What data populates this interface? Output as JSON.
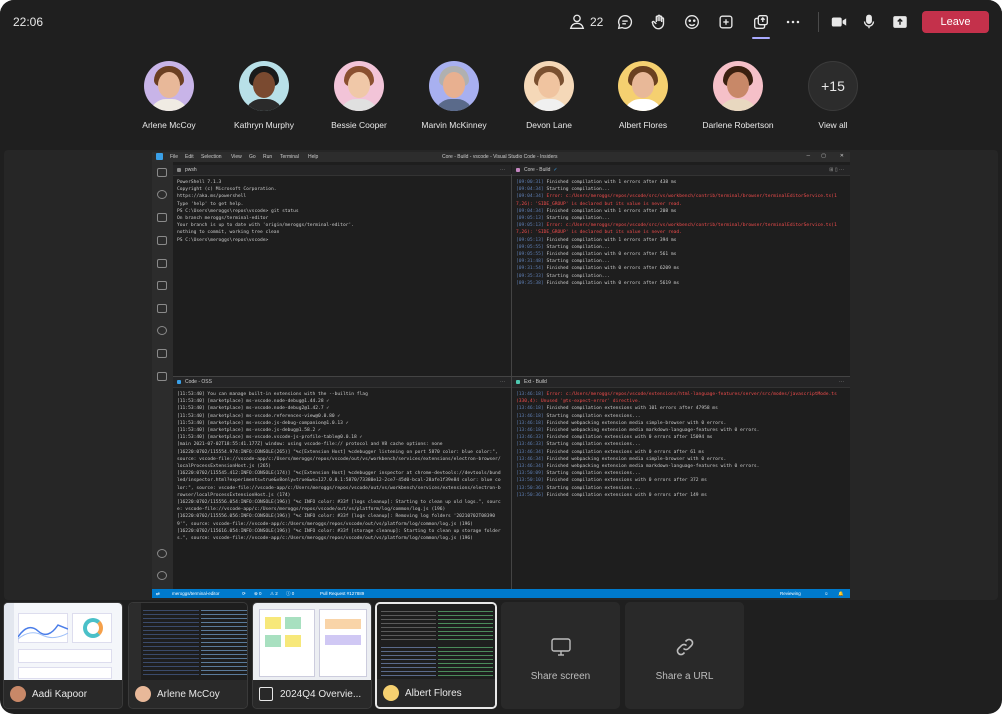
{
  "meeting": {
    "time": "22:06",
    "participant_count": "22",
    "leave_label": "Leave",
    "colors": {
      "leave": "#c4314b",
      "accent": "#a9aaff",
      "background": "#1f1f1f"
    }
  },
  "toolbar": {
    "icons": [
      "people-icon",
      "chat-icon",
      "raise-hand-icon",
      "reactions-icon",
      "apps-icon",
      "share-tray-icon",
      "more-icon",
      "camera-icon",
      "mic-icon",
      "share-icon"
    ]
  },
  "participants": [
    {
      "name": "Arlene McCoy"
    },
    {
      "name": "Kathryn Murphy"
    },
    {
      "name": "Bessie Cooper"
    },
    {
      "name": "Marvin McKinney"
    },
    {
      "name": "Devon Lane"
    },
    {
      "name": "Albert Flores"
    },
    {
      "name": "Darlene Robertson"
    }
  ],
  "overflow": {
    "count": "+15",
    "view_all_label": "View all"
  },
  "vscode": {
    "menu": [
      "File",
      "Edit",
      "Selection",
      "View",
      "Go",
      "Run",
      "Terminal",
      "Help"
    ],
    "title": "Core - Build - vscode - Visual Studio Code - Insiders",
    "panes": {
      "top_left": {
        "title": "pwsh",
        "lines": [
          "PowerShell 7.1.3",
          "Copyright (c) Microsoft Corporation.",
          "",
          "https://aka.ms/powershell",
          "Type 'help' to get help.",
          "",
          "PS C:\\Users\\meroggs\\repos\\vscode> git status",
          "On branch meroggs/terminal-editor",
          "Your branch is up to date with 'origin/meroggs/terminal-editor'.",
          "",
          "nothing to commit, working tree clean",
          "PS C:\\Users\\meroggs\\repos\\vscode> "
        ]
      },
      "top_right": {
        "title": "Core - Build",
        "lines": [
          {
            "ts": "[09:00:31]",
            "text": " Finished compilation with 1 errors after 438 ms"
          },
          {
            "ts": "[09:04:34]",
            "text": " Starting compilation..."
          },
          {
            "ts": "[09:04:34]",
            "text": " Error: c:/Users/meroggs/repos/vscode/src/vs/workbench/contrib/terminal/browser/terminalEditorService.ts(17,26): 'SIDE_GROUP' is declared but its value is never read."
          },
          {
            "ts": "[09:04:34]",
            "text": " Finished compilation with 1 errors after 208 ms"
          },
          {
            "ts": "[09:05:13]",
            "text": " Starting compilation..."
          },
          {
            "ts": "[09:05:13]",
            "text": " Error: c:/Users/meroggs/repos/vscode/src/vs/workbench/contrib/terminal/browser/terminalEditorService.ts(17,26): 'SIDE_GROUP' is declared but its value is never read."
          },
          {
            "ts": "[09:05:13]",
            "text": " Finished compilation with 1 errors after 394 ms"
          },
          {
            "ts": "[09:05:55]",
            "text": " Starting compilation..."
          },
          {
            "ts": "[09:05:55]",
            "text": " Finished compilation with 0 errors after 561 ms"
          },
          {
            "ts": "[09:31:48]",
            "text": " Starting compilation..."
          },
          {
            "ts": "[09:31:54]",
            "text": " Finished compilation with 0 errors after 6209 ms"
          },
          {
            "ts": "[09:35:33]",
            "text": " Starting compilation..."
          },
          {
            "ts": "[09:35:38]",
            "text": " Finished compilation with 0 errors after 5619 ms"
          }
        ]
      },
      "bottom_left": {
        "title": "Code - OSS",
        "lines": [
          "[11:53:40] You can manage built-in extensions with the --builtin flag",
          "[11:53:40] [marketplace] ms-vscode.node-debug@1.44.28 ✓",
          "[11:53:40] [marketplace] ms-vscode.node-debug2@1.42.7 ✓",
          "[11:53:40] [marketplace] ms-vscode.references-view@0.0.80 ✓",
          "[11:53:40] [marketplace] ms-vscode.js-debug-companion@1.0.13 ✓",
          "[11:53:40] [marketplace] ms-vscode.js-debug@1.58.2 ✓",
          "[11:53:40] [marketplace] ms-vscode.vscode-js-profile-table@0.0.18 ✓",
          "",
          "[main 2021-07-02T18:55:41.177Z] window: using vscode-file:// protocol and V8 cache options: none",
          "[16220:0702/115554.974:INFO:CONSOLE(265)] \"%c[Extension Host] %cdebugger listening on port 5870 color: blue color:\", source: vscode-file://vscode-app/c:/Users/meroggs/repos/vscode/out/vs/workbench/services/extensions/electron-browser/localProcessExtensionHost.js (265)",
          "[16220:0702/115545.412:INFO:CONSOLE(174)] \"%c[Extension Host] %cdebugger inspector at chrome-devtools://devtools/bundled/inspector.html?experiments=true&v8only=true&ws=127.0.0.1:5870/73380e12-2ce7-45d0-bcal-28afe1f39e84 color: blue color:\", source: vscode-file://vscode-app/c:/Users/meroggs/repos/vscode/out/vs/workbench/services/extensions/electron-browser/localProcessExtensionHost.js (174)",
          "[16220:0702/115556.054:INFO:CONSOLE(196)] \"%c INFO color: #33f [logs cleanup]: Starting to clean up old logs.\", source: vscode-file://vscode-app/c:/Users/meroggs/repos/vscode/out/vs/platform/log/common/log.js (196)",
          "[16220:0702/115556.056:INFO:CONSOLE(196)] \"%c INFO color: #33f [logs cleanup]: Removing log folders '20210702T083909'\", source: vscode-file://vscode-app/c:/Users/meroggs/repos/vscode/out/vs/platform/log/common/log.js (196)",
          "[16220:0702/115616.054:INFO:CONSOLE(196)] \"%c INFO color: #33f [storage cleanup]: Starting to clean up storage folders.\", source: vscode-file://vscode-app/c:/Users/meroggs/repos/vscode/out/vs/platform/log/common/log.js (196)"
        ]
      },
      "bottom_right": {
        "title": "Ext - Build",
        "lines": [
          {
            "ts": "[13:46:18]",
            "text": " Error: c:/Users/meroggs/repos/vscode/extensions/html-language-features/server/src/modes/javascriptMode.ts(330,4): Unused '@ts-expect-error' directive."
          },
          {
            "ts": "[13:46:18]",
            "text": " Finished compilation extensions with 101 errors after 47958 ms"
          },
          {
            "ts": "[13:46:18]",
            "text": " Starting compilation extensions..."
          },
          {
            "ts": "[13:46:18]",
            "text": " Finished webpacking extension media simple-browser with 0 errors."
          },
          {
            "ts": "[13:46:18]",
            "text": " Finished webpacking extension media markdown-language-features with 0 errors."
          },
          {
            "ts": "[13:46:33]",
            "text": " Finished compilation extensions with 0 errors after 15094 ms"
          },
          {
            "ts": "[13:46:33]",
            "text": " Starting compilation extensions..."
          },
          {
            "ts": "[13:46:34]",
            "text": " Finished compilation extensions with 0 errors after 61 ms"
          },
          {
            "ts": "[13:46:34]",
            "text": " Finished webpacking extension media simple-browser with 0 errors."
          },
          {
            "ts": "[13:46:34]",
            "text": " Finished webpacking extension media markdown-language-features with 0 errors."
          },
          {
            "ts": "[13:50:09]",
            "text": " Starting compilation extensions..."
          },
          {
            "ts": "[13:50:10]",
            "text": " Finished compilation extensions with 0 errors after 372 ms"
          },
          {
            "ts": "[13:50:36]",
            "text": " Starting compilation extensions..."
          },
          {
            "ts": "[13:50:36]",
            "text": " Finished compilation extensions with 0 errors after 149 ms"
          }
        ]
      }
    },
    "status_bar": {
      "branch": "meroggs/terminal-editor",
      "pr": "Pull Request #127889",
      "right": "Reviewing",
      "counts": [
        "0",
        "2",
        "0"
      ]
    }
  },
  "tray": {
    "tiles": [
      {
        "label": "Aadi Kapoor",
        "kind": "person"
      },
      {
        "label": "Arlene McCoy",
        "kind": "person"
      },
      {
        "label": "2024Q4 Overvie...",
        "kind": "file"
      },
      {
        "label": "Albert Flores",
        "kind": "person",
        "selected": true
      }
    ],
    "share_screen_label": "Share screen",
    "share_url_label": "Share a URL"
  }
}
